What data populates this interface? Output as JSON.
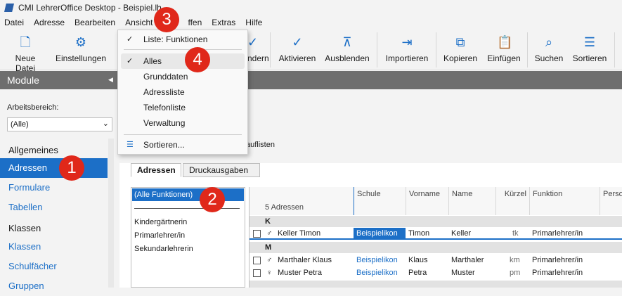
{
  "window": {
    "title": "CMI LehrerOffice Desktop - Beispiel.lh"
  },
  "menu": [
    "Datei",
    "Adresse",
    "Bearbeiten",
    "Ansicht",
    "ffen",
    "Extras",
    "Hilfe"
  ],
  "toolbar": [
    {
      "label": "Neue Datei",
      "icon": "new-file-icon"
    },
    {
      "label": "Einstellungen",
      "icon": "gear-icon"
    },
    {
      "label": "ndern",
      "icon": "edit-icon"
    },
    {
      "label": "Aktivieren",
      "icon": "check-icon"
    },
    {
      "label": "Ausblenden",
      "icon": "hide-icon"
    },
    {
      "label": "Importieren",
      "icon": "import-icon"
    },
    {
      "label": "Kopieren",
      "icon": "copy-icon"
    },
    {
      "label": "Einfügen",
      "icon": "paste-icon"
    },
    {
      "label": "Suchen",
      "icon": "search-icon"
    },
    {
      "label": "Sortieren",
      "icon": "sort-icon"
    }
  ],
  "sidebar": {
    "title": "Module",
    "workspace_label": "Arbeitsbereich:",
    "workspace_value": "(Alle)",
    "items": [
      {
        "label": "Allgemeines",
        "type": "header"
      },
      {
        "label": "Adressen",
        "type": "active"
      },
      {
        "label": "Formulare",
        "type": "link"
      },
      {
        "label": "Tabellen",
        "type": "link"
      },
      {
        "label": "Klassen",
        "type": "header"
      },
      {
        "label": "Klassen",
        "type": "link"
      },
      {
        "label": "Schulfächer",
        "type": "link"
      },
      {
        "label": "Gruppen",
        "type": "link"
      }
    ]
  },
  "main": {
    "auflisten_text": "auflisten",
    "tabs": [
      "Adressen",
      "Druckausgaben"
    ],
    "functions": {
      "all": "(Alle Funktionen)",
      "items": [
        "Kindergärtnerin",
        "Primarlehrer/in",
        "Sekundarlehrerin"
      ]
    },
    "grid": {
      "count_label": "5 Adressen",
      "headers": [
        "Schule",
        "Vorname",
        "Name",
        "Kürzel",
        "Funktion",
        "Perso"
      ],
      "groups": [
        {
          "letter": "K",
          "rows": [
            {
              "gender": "♂",
              "display": "Keller Timon",
              "schule": "Beispielikon",
              "vorname": "Timon",
              "name": "Keller",
              "kuerzel": "tk",
              "funktion": "Primarlehrer/in"
            }
          ]
        },
        {
          "letter": "M",
          "rows": [
            {
              "gender": "♂",
              "display": "Marthaler Klaus",
              "schule": "Beispielikon",
              "vorname": "Klaus",
              "name": "Marthaler",
              "kuerzel": "km",
              "funktion": "Primarlehrer/in"
            },
            {
              "gender": "♀",
              "display": "Muster Petra",
              "schule": "Beispielikon",
              "vorname": "Petra",
              "name": "Muster",
              "kuerzel": "pm",
              "funktion": "Primarlehrer/in"
            }
          ]
        }
      ]
    }
  },
  "view_menu": {
    "items": [
      "Liste: Funktionen",
      "Alles",
      "Grunddaten",
      "Adressliste",
      "Telefonliste",
      "Verwaltung",
      "Sortieren..."
    ]
  },
  "badges": [
    "3",
    "4",
    "1",
    "2"
  ],
  "colors": {
    "accent": "#1c6fc7",
    "badge": "#e0281a"
  }
}
